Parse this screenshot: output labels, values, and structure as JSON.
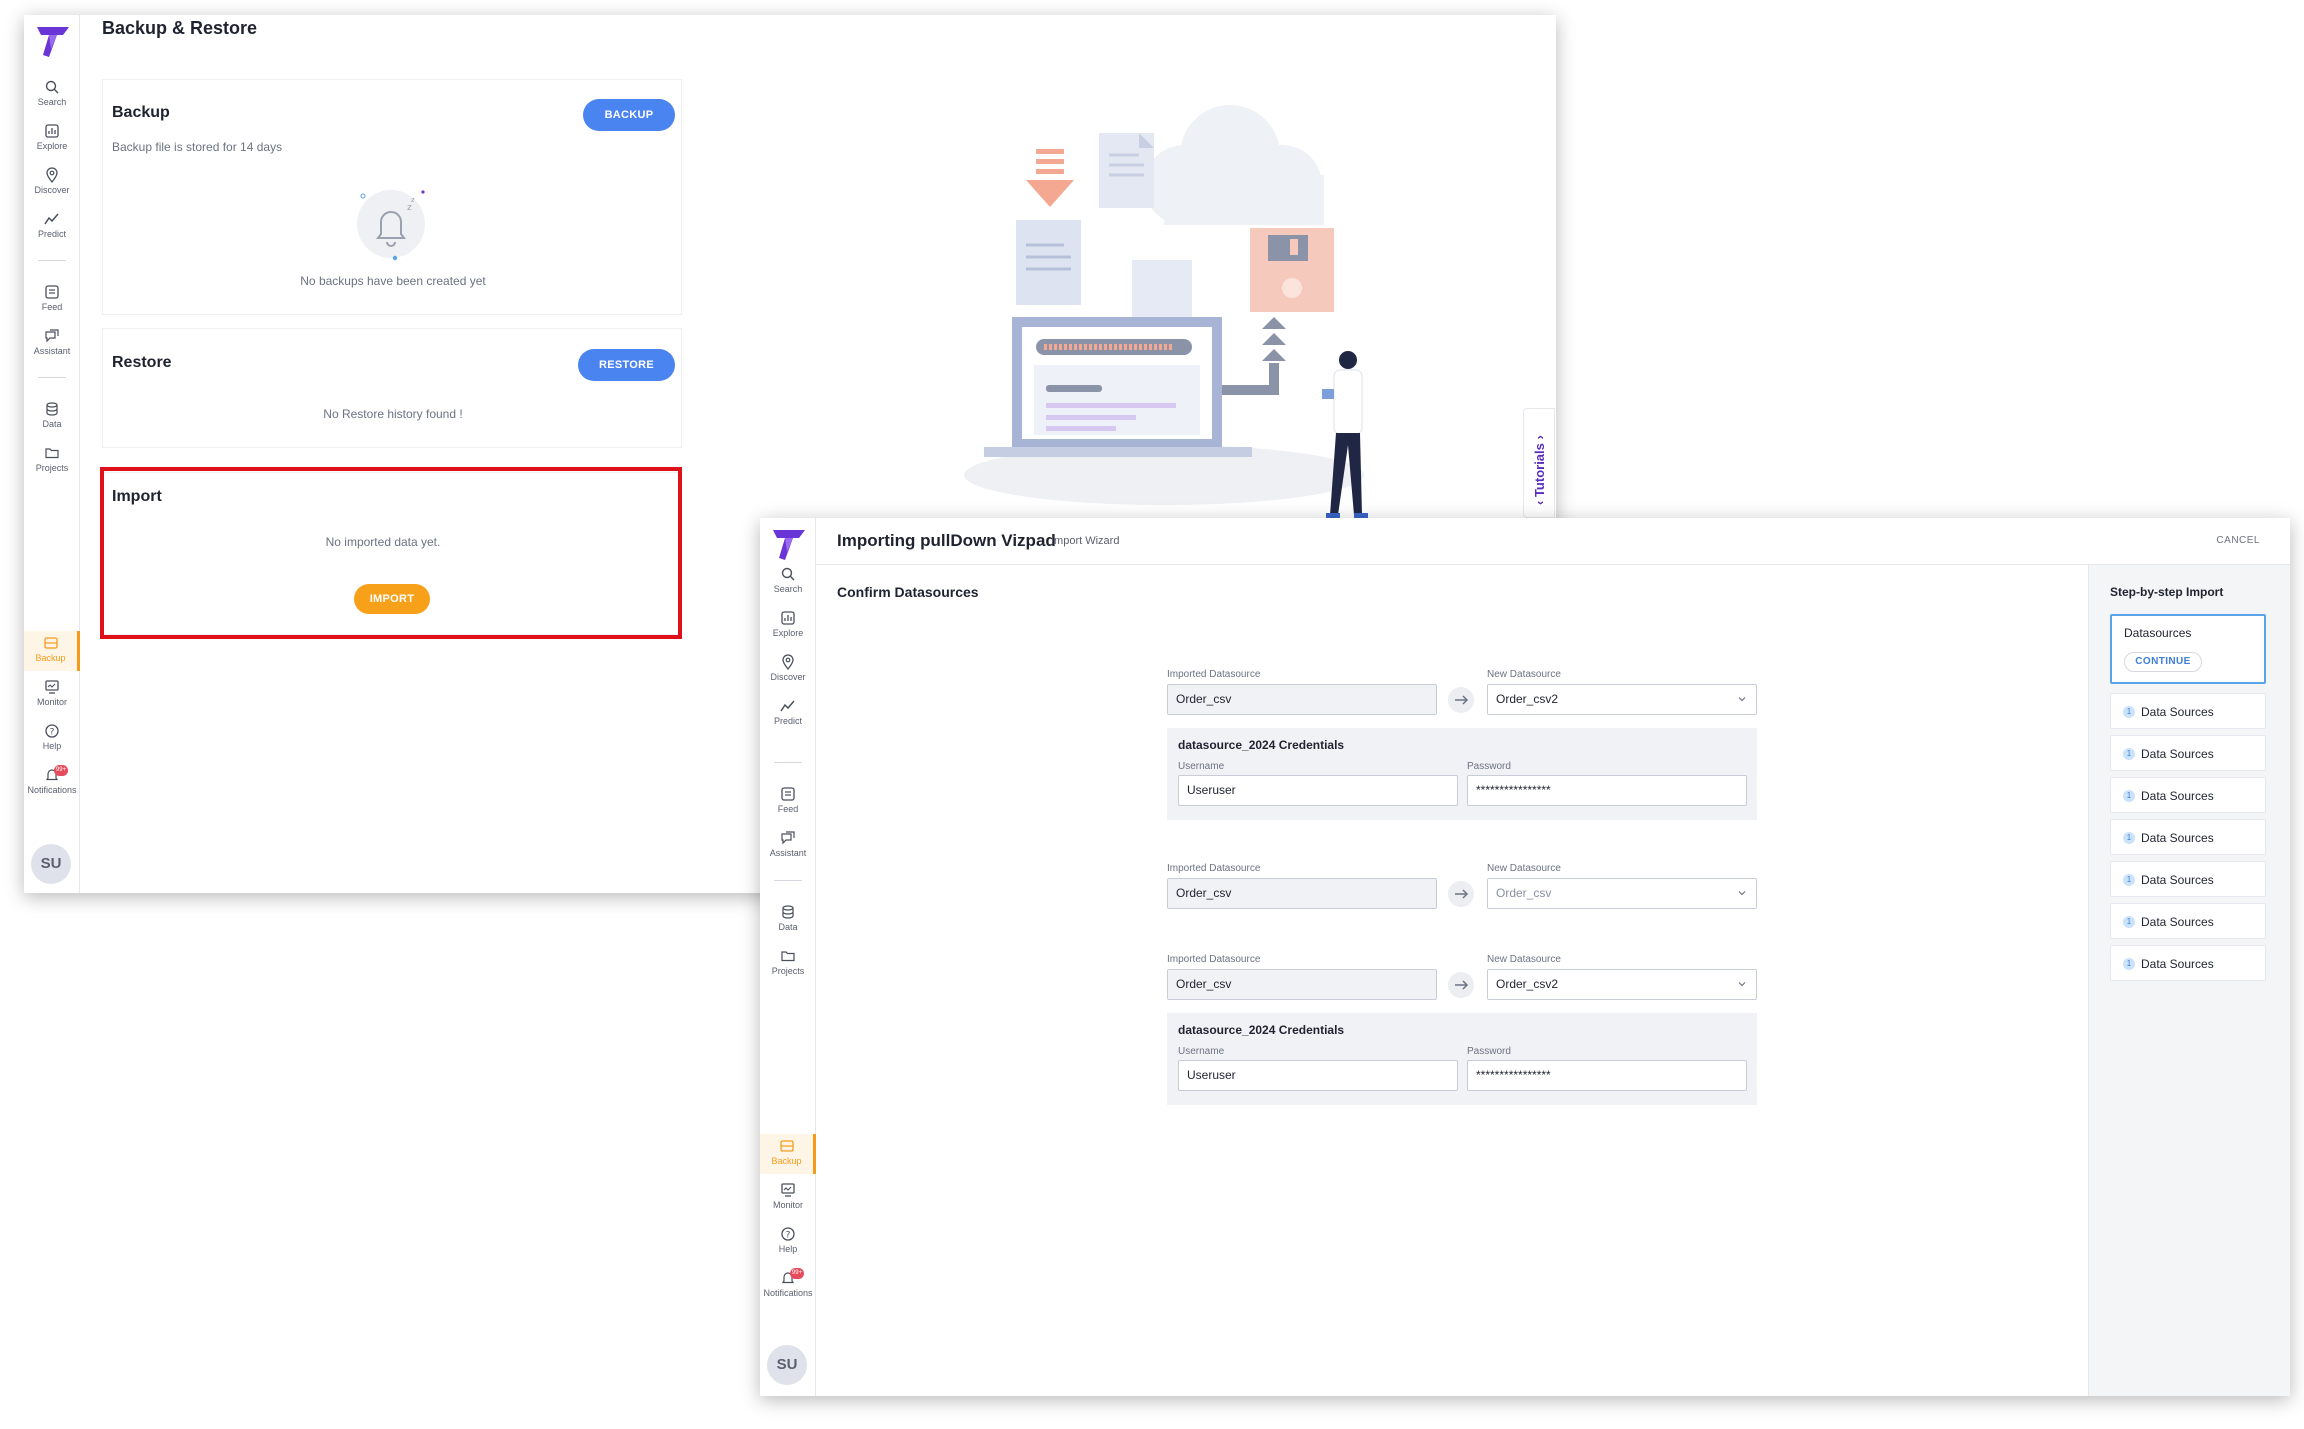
{
  "nav": {
    "search": "Search",
    "explore": "Explore",
    "discover": "Discover",
    "predict": "Predict",
    "feed": "Feed",
    "assistant": "Assistant",
    "data": "Data",
    "projects": "Projects",
    "backup": "Backup",
    "monitor": "Monitor",
    "help": "Help",
    "notifications": "Notifications",
    "notifications_badge": "99+",
    "avatar": "SU"
  },
  "backup_page": {
    "title": "Backup & Restore",
    "backup": {
      "title": "Backup",
      "button": "BACKUP",
      "subtitle": "Backup file is stored for 14 days",
      "empty": "No backups have been created yet"
    },
    "restore": {
      "title": "Restore",
      "button": "RESTORE",
      "empty": "No Restore history found !"
    },
    "import": {
      "title": "Import",
      "empty": "No imported data yet.",
      "button": "IMPORT"
    },
    "tutorials": "Tutorials"
  },
  "wizard": {
    "title": "Importing pullDown Vizpad",
    "subtitle": "Import Wizard",
    "cancel": "CANCEL",
    "section": "Confirm Datasources",
    "imported_label": "Imported Datasource",
    "new_label": "New Datasource",
    "username_label": "Username",
    "password_label": "Password",
    "rows": [
      {
        "imported": "Order_csv",
        "new": "Order_csv2",
        "cred_title": "datasource_2024 Credentials",
        "username": "Useruser",
        "password": "****************"
      },
      {
        "imported": "Order_csv",
        "new": "Order_csv"
      },
      {
        "imported": "Order_csv",
        "new": "Order_csv2",
        "cred_title": "datasource_2024 Credentials",
        "username": "Useruser",
        "password": "****************"
      }
    ],
    "steps_title": "Step-by-step Import",
    "active_step": {
      "title": "Datasources",
      "button": "CONTINUE"
    },
    "steps": [
      {
        "num": "1",
        "label": "Data Sources"
      },
      {
        "num": "1",
        "label": "Data Sources"
      },
      {
        "num": "1",
        "label": "Data Sources"
      },
      {
        "num": "1",
        "label": "Data Sources"
      },
      {
        "num": "1",
        "label": "Data Sources"
      },
      {
        "num": "1",
        "label": "Data Sources"
      },
      {
        "num": "1",
        "label": "Data Sources"
      }
    ]
  },
  "colors": {
    "accent": "#4a84f0",
    "import": "#f7a11a",
    "highlight": "#e0101b",
    "brand": "#6a35d6"
  }
}
